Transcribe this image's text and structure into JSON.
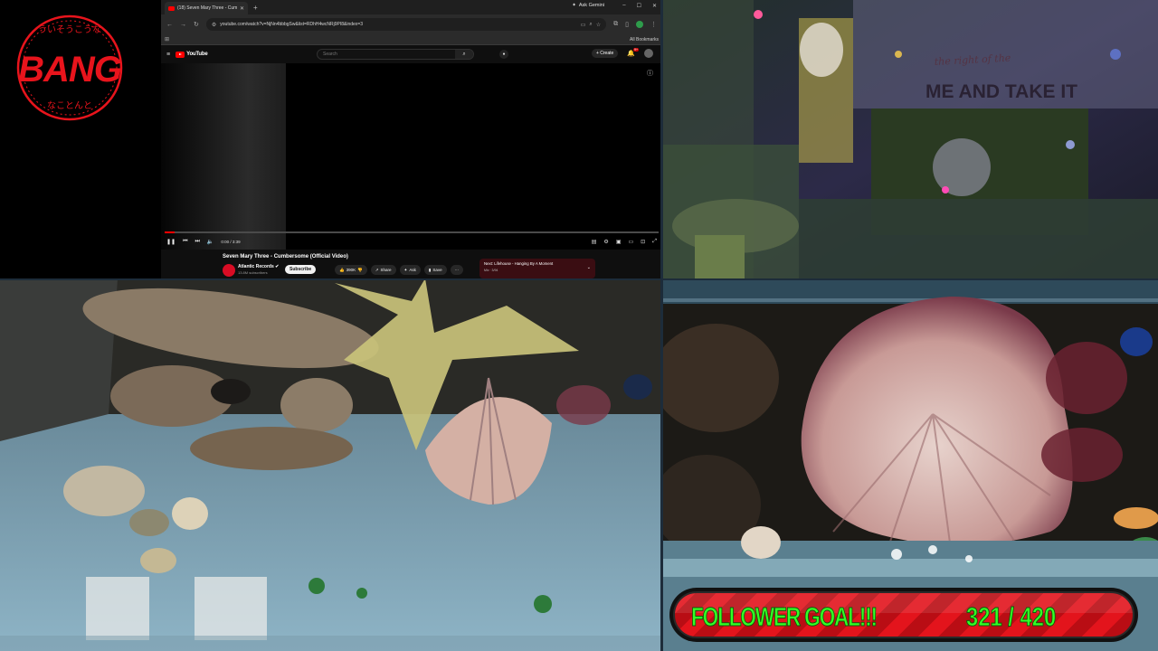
{
  "logo": {
    "text": "BANG",
    "ring_text_top": "ういそうこうな",
    "ring_text_bottom": "なことんと",
    "color": "#e8141c"
  },
  "browser": {
    "tab_title": "(18) Seven Mary Three - Cumb",
    "new_tab": "+",
    "gemini_label": "Ask Gemini",
    "url": "youtube.com/watch?v=NjNn4bbbgSw&list=RDhH4wcNRj9PI8&index=3",
    "all_bookmarks": "All Bookmarks",
    "icons": [
      "back-arrow-icon",
      "forward-arrow-icon",
      "reload-icon",
      "star-icon",
      "extensions-icon",
      "profile-icon"
    ]
  },
  "youtube": {
    "logo_text": "YouTube",
    "search_placeholder": "Search",
    "create_label": "Create",
    "notification_count": "9+",
    "video_time": "0:00 / 3:39",
    "progress_fraction": 0.004,
    "video_title": "Seven Mary Three - Cumbersome (Official Video)",
    "channel_name": "Atlantic Records",
    "channel_subs": "13.8M subscribers",
    "subscribe_label": "Subscribe",
    "like_count": "390K",
    "share_label": "Share",
    "ask_label": "Ask",
    "save_label": "Save",
    "more_label": "···",
    "up_next_title": "Next: Lifehouse - Hanging By A Moment",
    "up_next_sub": "Mix · 3/94",
    "accent": "#ff0000"
  },
  "goal": {
    "label": "FOLLOWER GOAL!!!",
    "count": "321 / 420",
    "current": 321,
    "target": 420,
    "text_color": "#34ff26",
    "bar_color": "#e3141c"
  },
  "cams": {
    "room_sign": "ME AND TAKE IT",
    "room_sign_small": "the right of the"
  }
}
